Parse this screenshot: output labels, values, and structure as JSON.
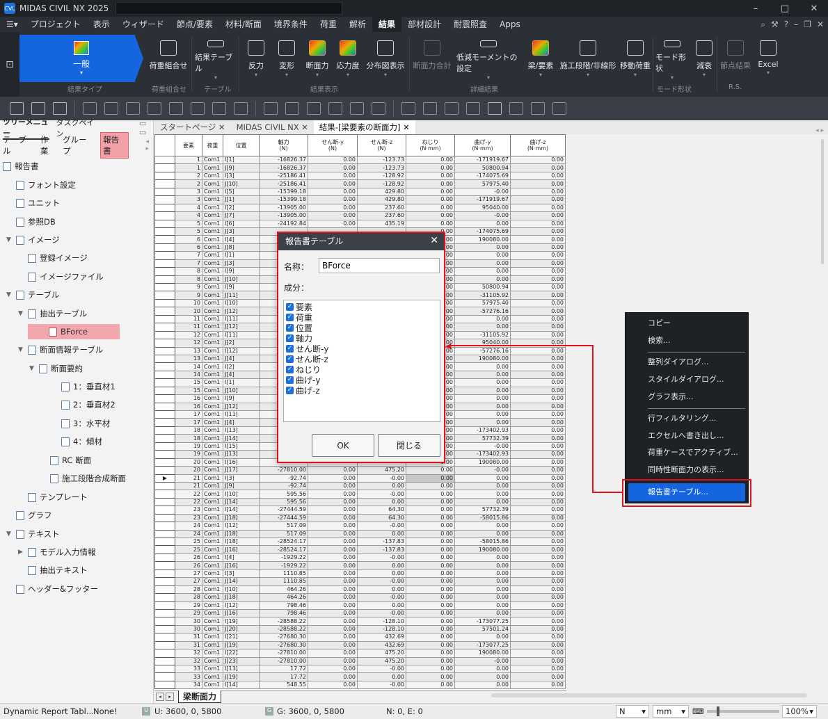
{
  "app": {
    "title": "MIDAS CIVIL NX 2025",
    "logo_text": "CVL",
    "window_controls": [
      "–",
      "□",
      "✕"
    ]
  },
  "menu": {
    "items": [
      "プロジェクト",
      "表示",
      "ウィザード",
      "節点/要素",
      "材料/断面",
      "境界条件",
      "荷重",
      "解析",
      "結果",
      "部材設計",
      "耐震照査",
      "Apps"
    ],
    "active": "結果"
  },
  "ribbon": {
    "general_label": "一般",
    "buttons": [
      "荷重組合せ",
      "結果テーブル",
      "反力",
      "変形",
      "断面力",
      "応力度",
      "分布図表示",
      "断面力合計",
      "低減モーメントの設定",
      "梁/要素",
      "施工段階/非線形",
      "移動荷重",
      "モード形状",
      "減衰",
      "節点結果",
      "Excel"
    ],
    "groups": [
      "結果タイプ",
      "荷重組合せ",
      "テーブル",
      "結果表示",
      "詳細結果",
      "モード形状",
      "R.S."
    ]
  },
  "left_panel": {
    "tabs": [
      "ツリーメニュー",
      "タスクペイン"
    ],
    "sub_tabs": [
      "テーブル",
      "作業",
      "グループ",
      "報告書"
    ],
    "active_sub_tab": "報告書",
    "tree": [
      "報告書",
      "フォント設定",
      "ユニット",
      "参照DB",
      "イメージ",
      "登録イメージ",
      "イメージファイル",
      "テーブル",
      "抽出テーブル",
      "BForce",
      "断面情報テーブル",
      "断面要約",
      "1：垂直材1",
      "2：垂直材2",
      "3：水平材",
      "4：傾材",
      "RC 断面",
      "施工段階合成断面",
      "テンプレート",
      "グラフ",
      "テキスト",
      "モデル入力情報",
      "抽出テキスト",
      "ヘッダー&フッター"
    ]
  },
  "doc_tabs": [
    "スタートページ",
    "MIDAS CIVIL NX",
    "結果-[梁要素の断面力]"
  ],
  "table": {
    "headers": [
      "要素",
      "荷重",
      "位置",
      "軸力\n(N)",
      "せん断-y\n(N)",
      "せん断-z\n(N)",
      "ねじり\n(N·mm)",
      "曲げ-y\n(N·mm)",
      "曲げ-z\n(N·mm)"
    ],
    "rows": [
      [
        "1",
        "Com1",
        "I[1]",
        "-16826.37",
        "0.00",
        "-123.73",
        "0.00",
        "-171919.67",
        "0.00"
      ],
      [
        "1",
        "Com1",
        "J[9]",
        "-16826.37",
        "0.00",
        "-123.73",
        "0.00",
        "50800.94",
        "0.00"
      ],
      [
        "2",
        "Com1",
        "I[3]",
        "-25186.41",
        "0.00",
        "-128.92",
        "0.00",
        "-174075.69",
        "0.00"
      ],
      [
        "2",
        "Com1",
        "J[10]",
        "-25186.41",
        "0.00",
        "-128.92",
        "0.00",
        "57975.40",
        "0.00"
      ],
      [
        "3",
        "Com1",
        "I[5]",
        "-15399.18",
        "0.00",
        "429.80",
        "0.00",
        "-0.00",
        "0.00"
      ],
      [
        "3",
        "Com1",
        "J[1]",
        "-15399.18",
        "0.00",
        "429.80",
        "0.00",
        "-171919.67",
        "0.00"
      ],
      [
        "4",
        "Com1",
        "I[2]",
        "-13905.00",
        "0.00",
        "237.60",
        "0.00",
        "95040.00",
        "0.00"
      ],
      [
        "4",
        "Com1",
        "J[7]",
        "-13905.00",
        "0.00",
        "237.60",
        "0.00",
        "-0.00",
        "0.00"
      ],
      [
        "5",
        "Com1",
        "I[6]",
        "-24192.84",
        "0.00",
        "435.19",
        "0.00",
        "0.00",
        "0.00"
      ],
      [
        "5",
        "Com1",
        "J[3]",
        "",
        "",
        "",
        "0.00",
        "-174075.69",
        "0.00"
      ],
      [
        "6",
        "Com1",
        "I[4]",
        "",
        "",
        "",
        "0.00",
        "190080.00",
        "0.00"
      ],
      [
        "6",
        "Com1",
        "J[8]",
        "",
        "",
        "",
        "0.00",
        "0.00",
        "0.00"
      ],
      [
        "7",
        "Com1",
        "I[1]",
        "",
        "",
        "",
        "0.00",
        "0.00",
        "0.00"
      ],
      [
        "7",
        "Com1",
        "J[3]",
        "",
        "",
        "",
        "0.00",
        "0.00",
        "0.00"
      ],
      [
        "8",
        "Com1",
        "I[9]",
        "",
        "",
        "",
        "0.00",
        "0.00",
        "0.00"
      ],
      [
        "8",
        "Com1",
        "J[10]",
        "",
        "",
        "",
        "0.00",
        "0.00",
        "0.00"
      ],
      [
        "9",
        "Com1",
        "I[9]",
        "",
        "",
        "",
        "0.00",
        "50800.94",
        "0.00"
      ],
      [
        "9",
        "Com1",
        "J[11]",
        "",
        "",
        "",
        "0.00",
        "-31105.92",
        "0.00"
      ],
      [
        "10",
        "Com1",
        "I[10]",
        "",
        "",
        "",
        "0.00",
        "57975.40",
        "0.00"
      ],
      [
        "10",
        "Com1",
        "J[12]",
        "",
        "",
        "",
        "0.00",
        "-57276.16",
        "0.00"
      ],
      [
        "11",
        "Com1",
        "I[11]",
        "",
        "",
        "",
        "0.00",
        "0.00",
        "0.00"
      ],
      [
        "11",
        "Com1",
        "J[12]",
        "",
        "",
        "",
        "0.00",
        "0.00",
        "0.00"
      ],
      [
        "12",
        "Com1",
        "I[11]",
        "",
        "",
        "",
        "0.00",
        "-31105.92",
        "0.00"
      ],
      [
        "12",
        "Com1",
        "J[2]",
        "",
        "",
        "",
        "0.00",
        "95040.00",
        "0.00"
      ],
      [
        "13",
        "Com1",
        "I[12]",
        "",
        "",
        "",
        "0.00",
        "-57276.16",
        "0.00"
      ],
      [
        "13",
        "Com1",
        "J[4]",
        "",
        "",
        "",
        "0.00",
        "190080.00",
        "0.00"
      ],
      [
        "14",
        "Com1",
        "I[2]",
        "",
        "",
        "",
        "0.00",
        "0.00",
        "0.00"
      ],
      [
        "14",
        "Com1",
        "J[4]",
        "",
        "",
        "",
        "0.00",
        "0.00",
        "0.00"
      ],
      [
        "15",
        "Com1",
        "I[1]",
        "",
        "",
        "",
        "0.00",
        "0.00",
        "0.00"
      ],
      [
        "15",
        "Com1",
        "J[10]",
        "",
        "",
        "",
        "0.00",
        "0.00",
        "0.00"
      ],
      [
        "16",
        "Com1",
        "I[9]",
        "",
        "",
        "",
        "0.00",
        "0.00",
        "0.00"
      ],
      [
        "16",
        "Com1",
        "J[12]",
        "",
        "",
        "",
        "0.00",
        "0.00",
        "0.00"
      ],
      [
        "17",
        "Com1",
        "I[11]",
        "",
        "",
        "",
        "0.00",
        "0.00",
        "0.00"
      ],
      [
        "17",
        "Com1",
        "J[4]",
        "",
        "",
        "",
        "0.00",
        "0.00",
        "0.00"
      ],
      [
        "18",
        "Com1",
        "I[13]",
        "",
        "",
        "",
        "0.00",
        "-173402.93",
        "0.00"
      ],
      [
        "18",
        "Com1",
        "J[14]",
        "",
        "",
        "",
        "0.00",
        "57732.39",
        "0.00"
      ],
      [
        "19",
        "Com1",
        "I[15]",
        "",
        "",
        "",
        "0.00",
        "-0.00",
        "0.00"
      ],
      [
        "19",
        "Com1",
        "J[13]",
        "",
        "",
        "",
        "0.00",
        "-173402.93",
        "0.00"
      ],
      [
        "20",
        "Com1",
        "I[16]",
        "",
        "",
        "",
        "0.00",
        "190080.00",
        "0.00"
      ],
      [
        "20",
        "Com1",
        "J[17]",
        "-27810.00",
        "0.00",
        "475.20",
        "0.00",
        "-0.00",
        "0.00"
      ],
      [
        "21",
        "Com1",
        "I[3]",
        "-92.74",
        "0.00",
        "-0.00",
        "0.00",
        "0.00",
        "0.00"
      ],
      [
        "21",
        "Com1",
        "J[9]",
        "-92.74",
        "0.00",
        "0.00",
        "0.00",
        "0.00",
        "0.00"
      ],
      [
        "22",
        "Com1",
        "I[10]",
        "595.56",
        "0.00",
        "-0.00",
        "0.00",
        "0.00",
        "0.00"
      ],
      [
        "22",
        "Com1",
        "J[14]",
        "595.56",
        "0.00",
        "0.00",
        "0.00",
        "0.00",
        "0.00"
      ],
      [
        "23",
        "Com1",
        "I[14]",
        "-27444.59",
        "0.00",
        "64.30",
        "0.00",
        "57732.39",
        "0.00"
      ],
      [
        "23",
        "Com1",
        "J[18]",
        "-27444.59",
        "0.00",
        "64.30",
        "0.00",
        "-58015.86",
        "0.00"
      ],
      [
        "24",
        "Com1",
        "I[12]",
        "517.09",
        "0.00",
        "-0.00",
        "0.00",
        "0.00",
        "0.00"
      ],
      [
        "24",
        "Com1",
        "J[18]",
        "517.09",
        "0.00",
        "0.00",
        "0.00",
        "0.00",
        "0.00"
      ],
      [
        "25",
        "Com1",
        "I[18]",
        "-28524.17",
        "0.00",
        "-137.83",
        "0.00",
        "-58015.86",
        "0.00"
      ],
      [
        "25",
        "Com1",
        "J[16]",
        "-28524.17",
        "0.00",
        "-137.83",
        "0.00",
        "190080.00",
        "0.00"
      ],
      [
        "26",
        "Com1",
        "I[4]",
        "-1929.22",
        "0.00",
        "-0.00",
        "0.00",
        "0.00",
        "0.00"
      ],
      [
        "26",
        "Com1",
        "J[16]",
        "-1929.22",
        "0.00",
        "0.00",
        "0.00",
        "0.00",
        "0.00"
      ],
      [
        "27",
        "Com1",
        "I[3]",
        "1110.85",
        "0.00",
        "0.00",
        "0.00",
        "0.00",
        "0.00"
      ],
      [
        "27",
        "Com1",
        "J[14]",
        "1110.85",
        "0.00",
        "-0.00",
        "0.00",
        "0.00",
        "0.00"
      ],
      [
        "28",
        "Com1",
        "I[10]",
        "464.26",
        "0.00",
        "0.00",
        "0.00",
        "0.00",
        "0.00"
      ],
      [
        "28",
        "Com1",
        "J[18]",
        "464.26",
        "0.00",
        "-0.00",
        "0.00",
        "0.00",
        "0.00"
      ],
      [
        "29",
        "Com1",
        "I[12]",
        "798.46",
        "0.00",
        "0.00",
        "0.00",
        "0.00",
        "0.00"
      ],
      [
        "29",
        "Com1",
        "J[16]",
        "798.46",
        "0.00",
        "-0.00",
        "0.00",
        "0.00",
        "0.00"
      ],
      [
        "30",
        "Com1",
        "I[19]",
        "-28588.22",
        "0.00",
        "-128.10",
        "0.00",
        "-173077.25",
        "0.00"
      ],
      [
        "30",
        "Com1",
        "J[20]",
        "-28588.22",
        "0.00",
        "-128.10",
        "0.00",
        "57501.24",
        "0.00"
      ],
      [
        "31",
        "Com1",
        "I[21]",
        "-27680.30",
        "0.00",
        "432.69",
        "0.00",
        "0.00",
        "0.00"
      ],
      [
        "31",
        "Com1",
        "J[19]",
        "-27680.30",
        "0.00",
        "432.69",
        "0.00",
        "-173077.25",
        "0.00"
      ],
      [
        "32",
        "Com1",
        "I[22]",
        "-27810.00",
        "0.00",
        "475.20",
        "0.00",
        "190080.00",
        "0.00"
      ],
      [
        "32",
        "Com1",
        "J[23]",
        "-27810.00",
        "0.00",
        "475.20",
        "0.00",
        "-0.00",
        "0.00"
      ],
      [
        "33",
        "Com1",
        "I[13]",
        "17.72",
        "0.00",
        "-0.00",
        "0.00",
        "0.00",
        "0.00"
      ],
      [
        "33",
        "Com1",
        "J[19]",
        "17.72",
        "0.00",
        "0.00",
        "0.00",
        "0.00",
        "0.00"
      ],
      [
        "34",
        "Com1",
        "I[14]",
        "548.55",
        "0.00",
        "-0.00",
        "0.00",
        "0.00",
        "0.00"
      ]
    ],
    "current_row_marker": "▶",
    "sheet_name": "梁断面力"
  },
  "dialog": {
    "title": "報告書テーブル",
    "name_label": "名称：",
    "name_value": "BForce",
    "components_label": "成分：",
    "components": [
      "要素",
      "荷重",
      "位置",
      "軸力",
      "せん断-y",
      "せん断-z",
      "ねじり",
      "曲げ-y",
      "曲げ-z"
    ],
    "ok_label": "OK",
    "close_label": "閉じる"
  },
  "context_menu": {
    "items": [
      "コピー",
      "検索...",
      "整列ダイアログ...",
      "スタイルダイアログ...",
      "グラフ表示...",
      "行フィルタリング...",
      "エクセルへ書き出し...",
      "荷重ケースでアクティブ...",
      "同時性断面力の表示...",
      "報告書テーブル..."
    ]
  },
  "status": {
    "left_text": "Dynamic Report Tabl...",
    "none_text": "None!",
    "u_coord": "U: 3600, 0, 5800",
    "g_coord": "G: 3600, 0, 5800",
    "ne": "N: 0, E: 0",
    "force_unit": "N",
    "length_unit": "mm",
    "zoom": "100%"
  },
  "colors": {
    "accent_blue": "#1565e0",
    "highlight_red": "#e0141e",
    "selection_pink": "#f2a7ae"
  }
}
